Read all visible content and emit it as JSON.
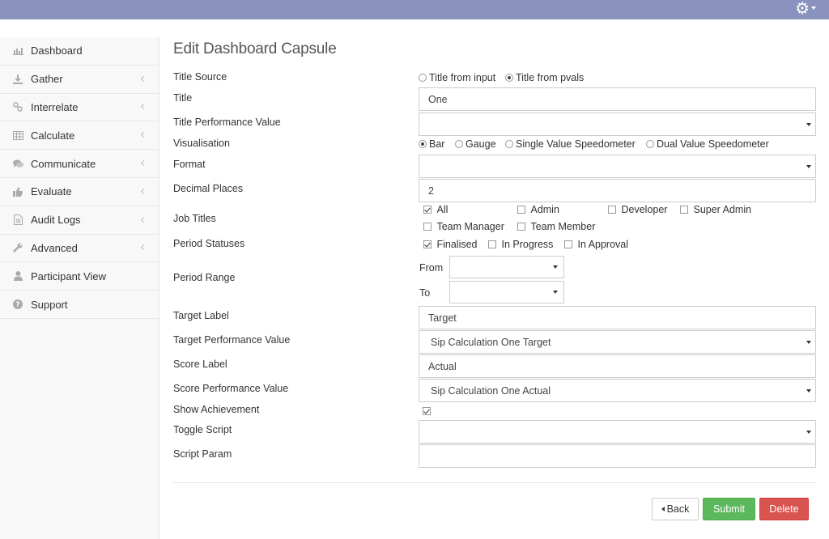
{
  "header": {
    "settings_icon": "gear-icon"
  },
  "sidebar": {
    "items": [
      {
        "label": "Dashboard",
        "icon": "bar-chart-icon",
        "chevron": false
      },
      {
        "label": "Gather",
        "icon": "download-icon",
        "chevron": true
      },
      {
        "label": "Interrelate",
        "icon": "link-icon",
        "chevron": true
      },
      {
        "label": "Calculate",
        "icon": "table-icon",
        "chevron": true
      },
      {
        "label": "Communicate",
        "icon": "comments-icon",
        "chevron": true
      },
      {
        "label": "Evaluate",
        "icon": "thumbs-up-icon",
        "chevron": true
      },
      {
        "label": "Audit Logs",
        "icon": "file-icon",
        "chevron": true
      },
      {
        "label": "Advanced",
        "icon": "wrench-icon",
        "chevron": true
      },
      {
        "label": "Participant View",
        "icon": "user-icon",
        "chevron": false
      },
      {
        "label": "Support",
        "icon": "question-icon",
        "chevron": false
      }
    ]
  },
  "form": {
    "title": "Edit Dashboard Capsule",
    "title_source": {
      "label": "Title Source",
      "opt1": "Title from input",
      "opt2": "Title from pvals",
      "selected": "opt2"
    },
    "title_field": {
      "label": "Title",
      "value": "One"
    },
    "title_pv": {
      "label": "Title Performance Value",
      "value": ""
    },
    "visualisation": {
      "label": "Visualisation",
      "opt1": "Bar",
      "opt2": "Gauge",
      "opt3": "Single Value Speedometer",
      "opt4": "Dual Value Speedometer",
      "selected": "opt1"
    },
    "format": {
      "label": "Format",
      "value": ""
    },
    "decimal_places": {
      "label": "Decimal Places",
      "value": "2"
    },
    "job_titles": {
      "label": "Job Titles",
      "all": "All",
      "admin": "Admin",
      "developer": "Developer",
      "super_admin": "Super Admin",
      "team_manager": "Team Manager",
      "team_member": "Team Member"
    },
    "period_statuses": {
      "label": "Period Statuses",
      "finalised": "Finalised",
      "in_progress": "In Progress",
      "in_approval": "In Approval"
    },
    "period_range": {
      "label": "Period Range",
      "from": "From",
      "to": "To"
    },
    "target_label": {
      "label": "Target Label",
      "value": "Target"
    },
    "target_pv": {
      "label": "Target Performance Value",
      "value": "Sip Calculation One Target"
    },
    "score_label": {
      "label": "Score Label",
      "value": "Actual"
    },
    "score_pv": {
      "label": "Score Performance Value",
      "value": "Sip Calculation One Actual"
    },
    "show_achievement": {
      "label": "Show Achievement"
    },
    "toggle_script": {
      "label": "Toggle Script",
      "value": ""
    },
    "script_param": {
      "label": "Script Param",
      "value": ""
    }
  },
  "actions": {
    "back": "Back",
    "submit": "Submit",
    "delete": "Delete"
  }
}
